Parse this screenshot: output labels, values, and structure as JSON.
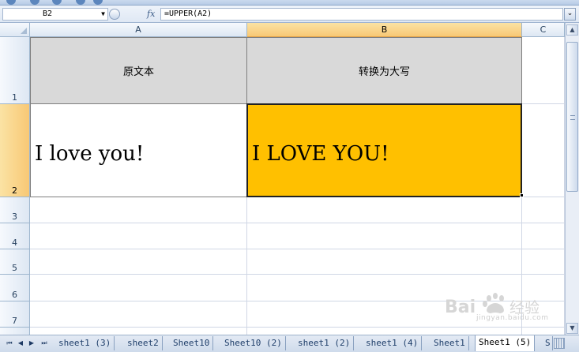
{
  "name_box": {
    "value": "B2"
  },
  "formula_bar": {
    "fx_label": "fx",
    "formula": "=UPPER(A2)"
  },
  "columns": [
    {
      "label": "A"
    },
    {
      "label": "B"
    },
    {
      "label": "C"
    }
  ],
  "rows": [
    "1",
    "2",
    "3",
    "4",
    "5",
    "6",
    "7"
  ],
  "cells": {
    "A1": "原文本",
    "B1": "转换为大写",
    "A2": "I love you!",
    "B2": "I LOVE YOU!"
  },
  "colors": {
    "selected_fill": "#ffc000",
    "header_fill": "#d9d9d9"
  },
  "sheet_tabs": [
    {
      "label": "sheet1 (3)"
    },
    {
      "label": "sheet2"
    },
    {
      "label": "Sheet10"
    },
    {
      "label": "Sheet10 (2)"
    },
    {
      "label": "sheet1 (2)"
    },
    {
      "label": "sheet1 (4)"
    },
    {
      "label": "Sheet1"
    },
    {
      "label": "Sheet1 (5)",
      "active": true
    },
    {
      "label": "S"
    }
  ],
  "watermark": {
    "text": "Bai 经验",
    "sub": "jingyan.baidu.com"
  }
}
